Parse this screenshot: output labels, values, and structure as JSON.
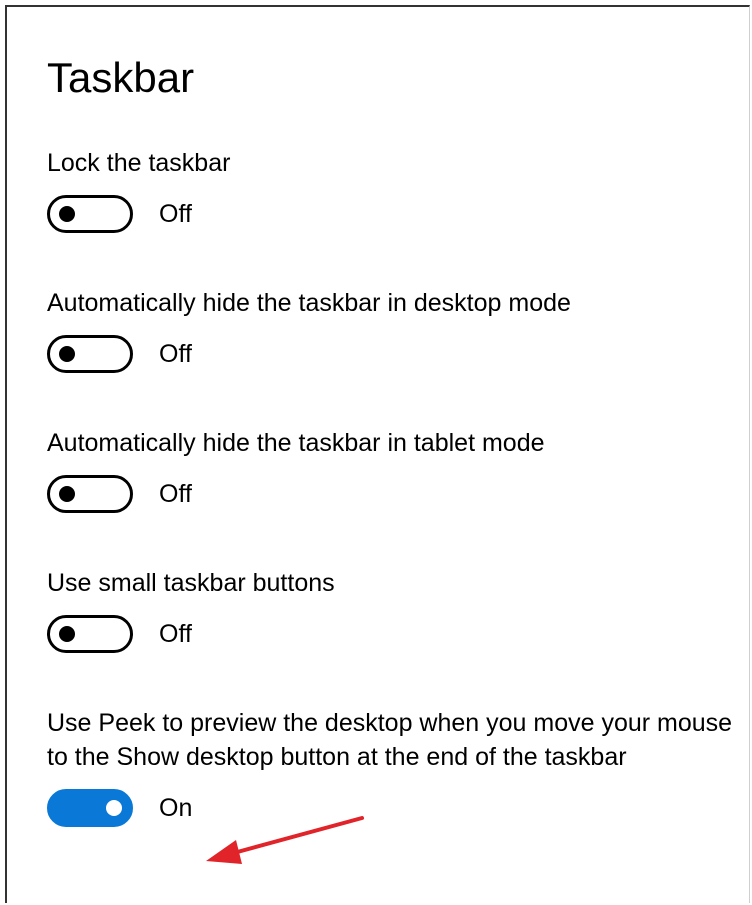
{
  "page": {
    "title": "Taskbar"
  },
  "settings": [
    {
      "label": "Lock the taskbar",
      "state_text": "Off",
      "on": false
    },
    {
      "label": "Automatically hide the taskbar in desktop mode",
      "state_text": "Off",
      "on": false
    },
    {
      "label": "Automatically hide the taskbar in tablet mode",
      "state_text": "Off",
      "on": false
    },
    {
      "label": "Use small taskbar buttons",
      "state_text": "Off",
      "on": false
    },
    {
      "label": "Use Peek to preview the desktop when you move your mouse to the Show desktop button at the end of the taskbar",
      "state_text": "On",
      "on": true
    }
  ],
  "colors": {
    "accent": "#0a78d7",
    "callout_arrow": "#e0242a"
  },
  "annotations": {
    "callout_arrow_icon": "arrow-pointing-left-icon"
  }
}
